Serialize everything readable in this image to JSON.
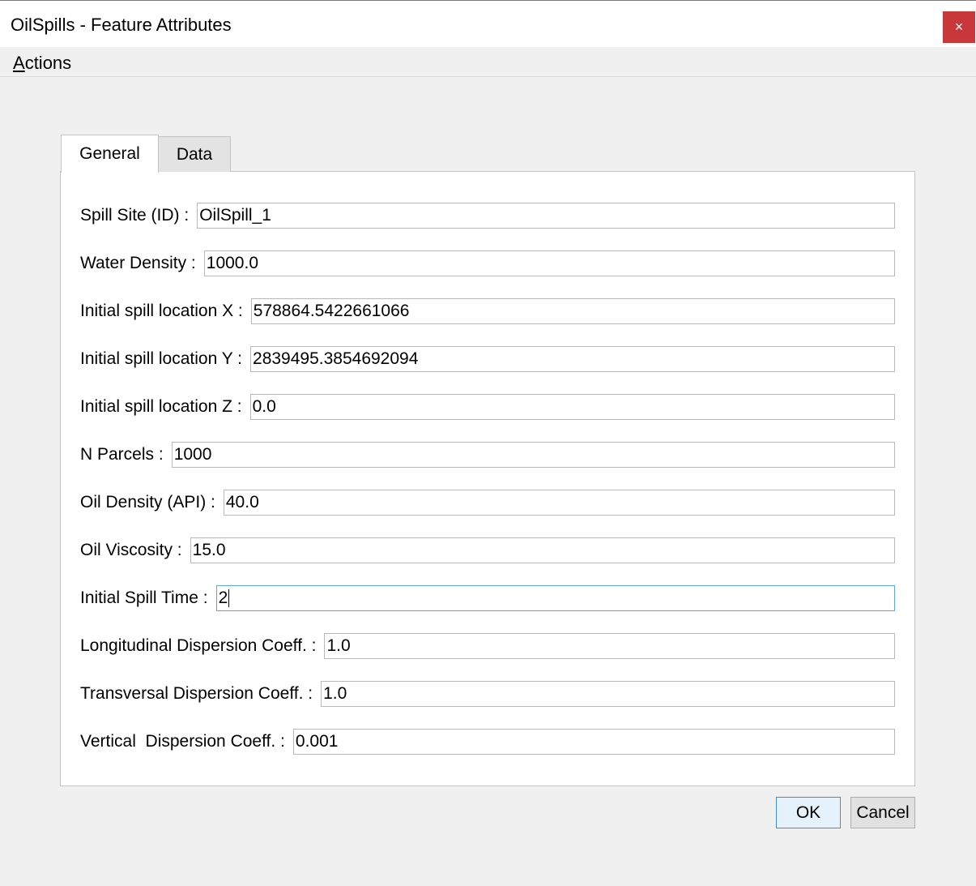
{
  "window": {
    "title": "OilSpills - Feature Attributes",
    "close_glyph": "×"
  },
  "menu": {
    "actions_accel": "A",
    "actions_rest": "ctions"
  },
  "tabs": [
    {
      "label": "General",
      "active": true
    },
    {
      "label": "Data",
      "active": false
    }
  ],
  "fields": [
    {
      "label": "Spill Site (ID) :",
      "value": "OilSpill_1"
    },
    {
      "label": "Water Density :",
      "value": "1000.0"
    },
    {
      "label": "Initial spill location X :",
      "value": "578864.5422661066"
    },
    {
      "label": "Initial spill location Y :",
      "value": "2839495.3854692094"
    },
    {
      "label": "Initial spill location Z :",
      "value": "0.0"
    },
    {
      "label": "N Parcels :",
      "value": "1000"
    },
    {
      "label": "Oil Density (API) :",
      "value": "40.0"
    },
    {
      "label": "Oil Viscosity :",
      "value": "15.0"
    },
    {
      "label": "Initial Spill Time :",
      "value": "2"
    },
    {
      "label": "Longitudinal Dispersion Coeff. :",
      "value": "1.0"
    },
    {
      "label": "Transversal Dispersion Coeff. :",
      "value": "1.0"
    },
    {
      "label": "Vertical  Dispersion Coeff. :",
      "value": "0.001"
    }
  ],
  "buttons": {
    "ok": "OK",
    "cancel": "Cancel"
  },
  "colors": {
    "close_button": "#c8383a",
    "focus_border": "#5aa7d9"
  },
  "icons": {
    "close": "close-icon"
  }
}
